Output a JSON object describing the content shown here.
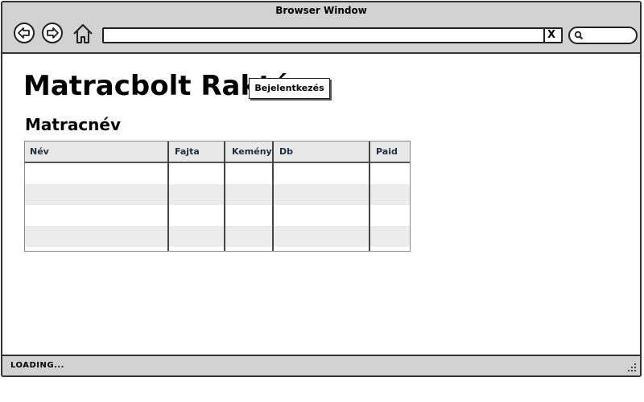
{
  "window": {
    "title": "Browser Window"
  },
  "toolbar": {
    "url_value": "",
    "clear_label": "X"
  },
  "page": {
    "heading": "Matracbolt Raktár",
    "login_button": "Bejelentkezés",
    "subheading": "Matracnév"
  },
  "table": {
    "columns": [
      "Név",
      "Fajta",
      "Keménysé",
      "Db",
      "Paid"
    ],
    "rows": [
      [
        "",
        "",
        "",
        "",
        ""
      ],
      [
        "",
        "",
        "",
        "",
        ""
      ],
      [
        "",
        "",
        "",
        "",
        ""
      ],
      [
        "",
        "",
        "",
        "",
        ""
      ]
    ]
  },
  "status": {
    "text": "LOADING..."
  },
  "icons": {
    "back": "back-arrow-icon",
    "forward": "forward-arrow-icon",
    "home": "home-icon",
    "search": "search-icon",
    "resize": "resize-grip-icon"
  }
}
